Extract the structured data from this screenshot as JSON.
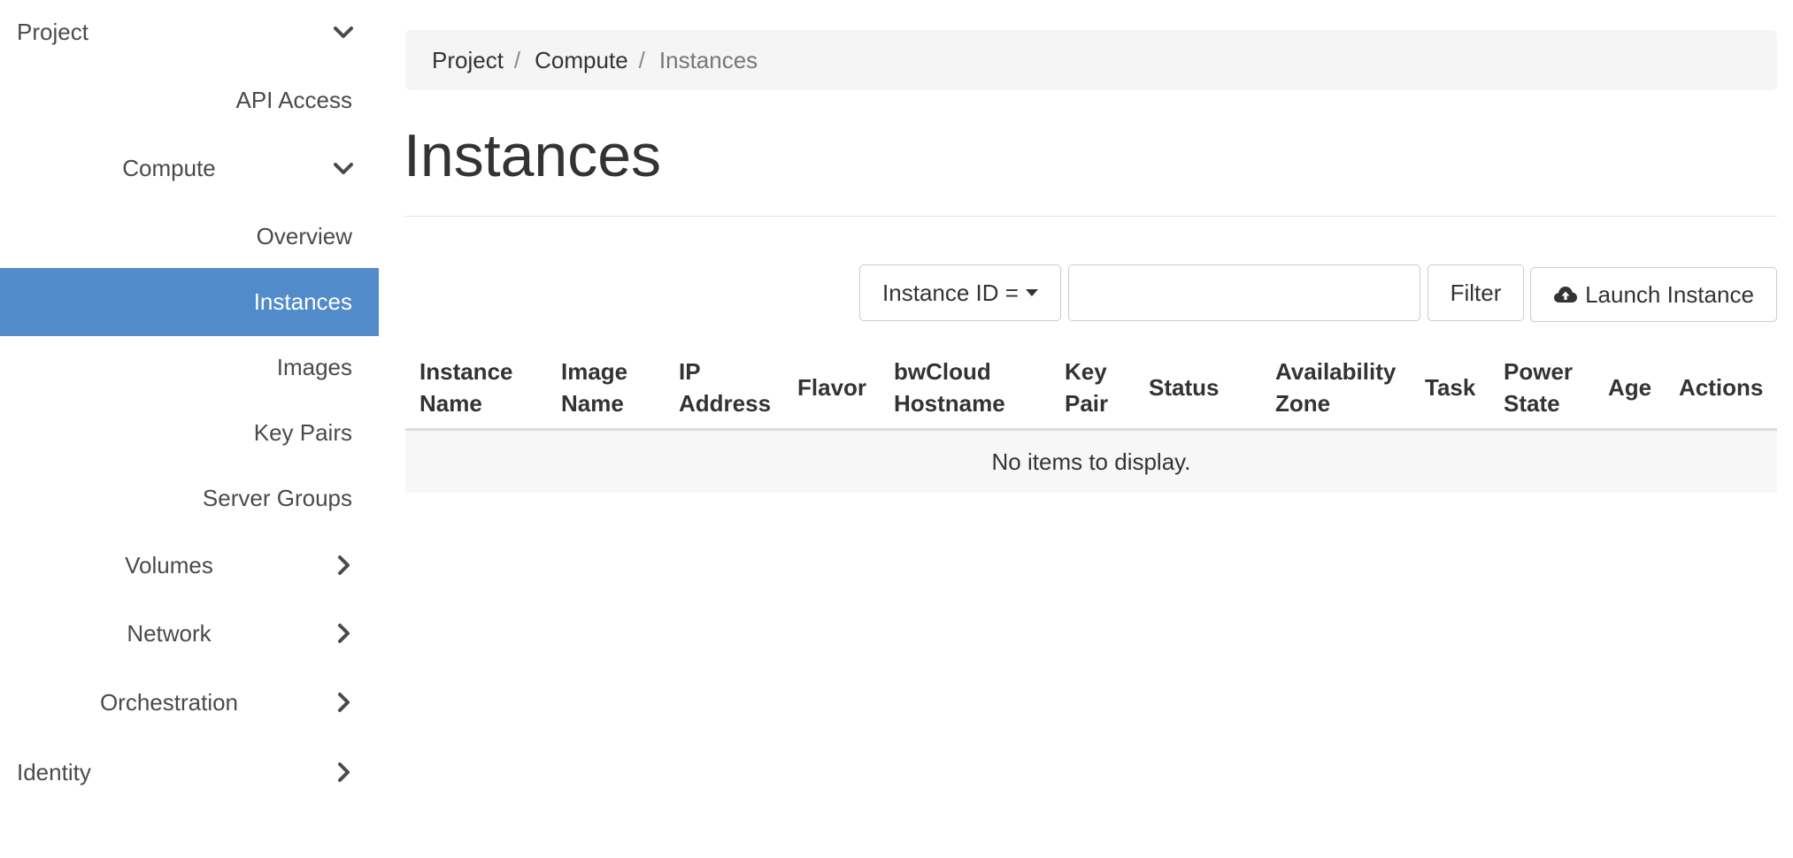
{
  "sidebar": {
    "items": [
      {
        "label": "Project",
        "icon": "chevron-down-icon"
      },
      {
        "label": "API Access"
      },
      {
        "label": "Compute",
        "icon": "chevron-down-icon"
      },
      {
        "label": "Overview"
      },
      {
        "label": "Instances",
        "active": true
      },
      {
        "label": "Images"
      },
      {
        "label": "Key Pairs"
      },
      {
        "label": "Server Groups"
      },
      {
        "label": "Volumes",
        "icon": "chevron-right-icon"
      },
      {
        "label": "Network",
        "icon": "chevron-right-icon"
      },
      {
        "label": "Orchestration",
        "icon": "chevron-right-icon"
      },
      {
        "label": "Identity",
        "icon": "chevron-right-icon"
      }
    ]
  },
  "breadcrumb": {
    "items": [
      "Project",
      "Compute",
      "Instances"
    ],
    "separator": "/"
  },
  "page": {
    "title": "Instances"
  },
  "toolbar": {
    "filter_field": "Instance ID =",
    "filter_value": "",
    "filter_label": "Filter",
    "launch_label": "Launch Instance",
    "launch_icon": "cloud-upload-icon"
  },
  "table": {
    "columns": [
      [
        "Instance",
        "Name"
      ],
      [
        "Image",
        "Name"
      ],
      [
        "IP",
        "Address"
      ],
      [
        "Flavor"
      ],
      [
        "bwCloud",
        "Hostname"
      ],
      [
        "Key",
        "Pair"
      ],
      [
        "Status"
      ],
      [
        "Availability",
        "Zone"
      ],
      [
        "Task"
      ],
      [
        "Power",
        "State"
      ],
      [
        "Age"
      ],
      [
        "Actions"
      ]
    ],
    "empty_message": "No items to display."
  },
  "colors": {
    "active_nav": "#528bc9",
    "breadcrumb_bg": "#f5f5f5",
    "empty_row_bg": "#f7f7f7"
  }
}
